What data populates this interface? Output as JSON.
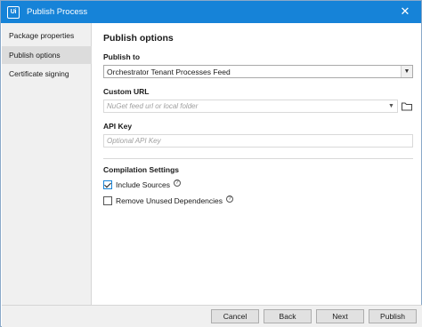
{
  "window": {
    "title": "Publish Process",
    "app_icon": "Ui",
    "close_glyph": "✕"
  },
  "sidebar": {
    "items": [
      {
        "label": "Package properties",
        "active": false
      },
      {
        "label": "Publish options",
        "active": true
      },
      {
        "label": "Certificate signing",
        "active": false
      }
    ]
  },
  "main": {
    "section_title": "Publish options",
    "publish_to": {
      "label": "Publish to",
      "value": "Orchestrator Tenant Processes Feed"
    },
    "custom_url": {
      "label": "Custom URL",
      "placeholder": "NuGet feed url or local folder"
    },
    "api_key": {
      "label": "API Key",
      "placeholder": "Optional API Key"
    },
    "compilation": {
      "label": "Compilation Settings",
      "include_sources": {
        "label": "Include Sources",
        "checked": true
      },
      "remove_unused": {
        "label": "Remove Unused Dependencies",
        "checked": false
      },
      "help_glyph": "?"
    }
  },
  "footer": {
    "cancel": "Cancel",
    "back": "Back",
    "next": "Next",
    "publish": "Publish"
  },
  "colors": {
    "titlebar": "#1683d8",
    "sidebar_bg": "#f0f0f0",
    "active_item_bg": "#dcdcdc",
    "button_bg": "#e1e1e1"
  }
}
